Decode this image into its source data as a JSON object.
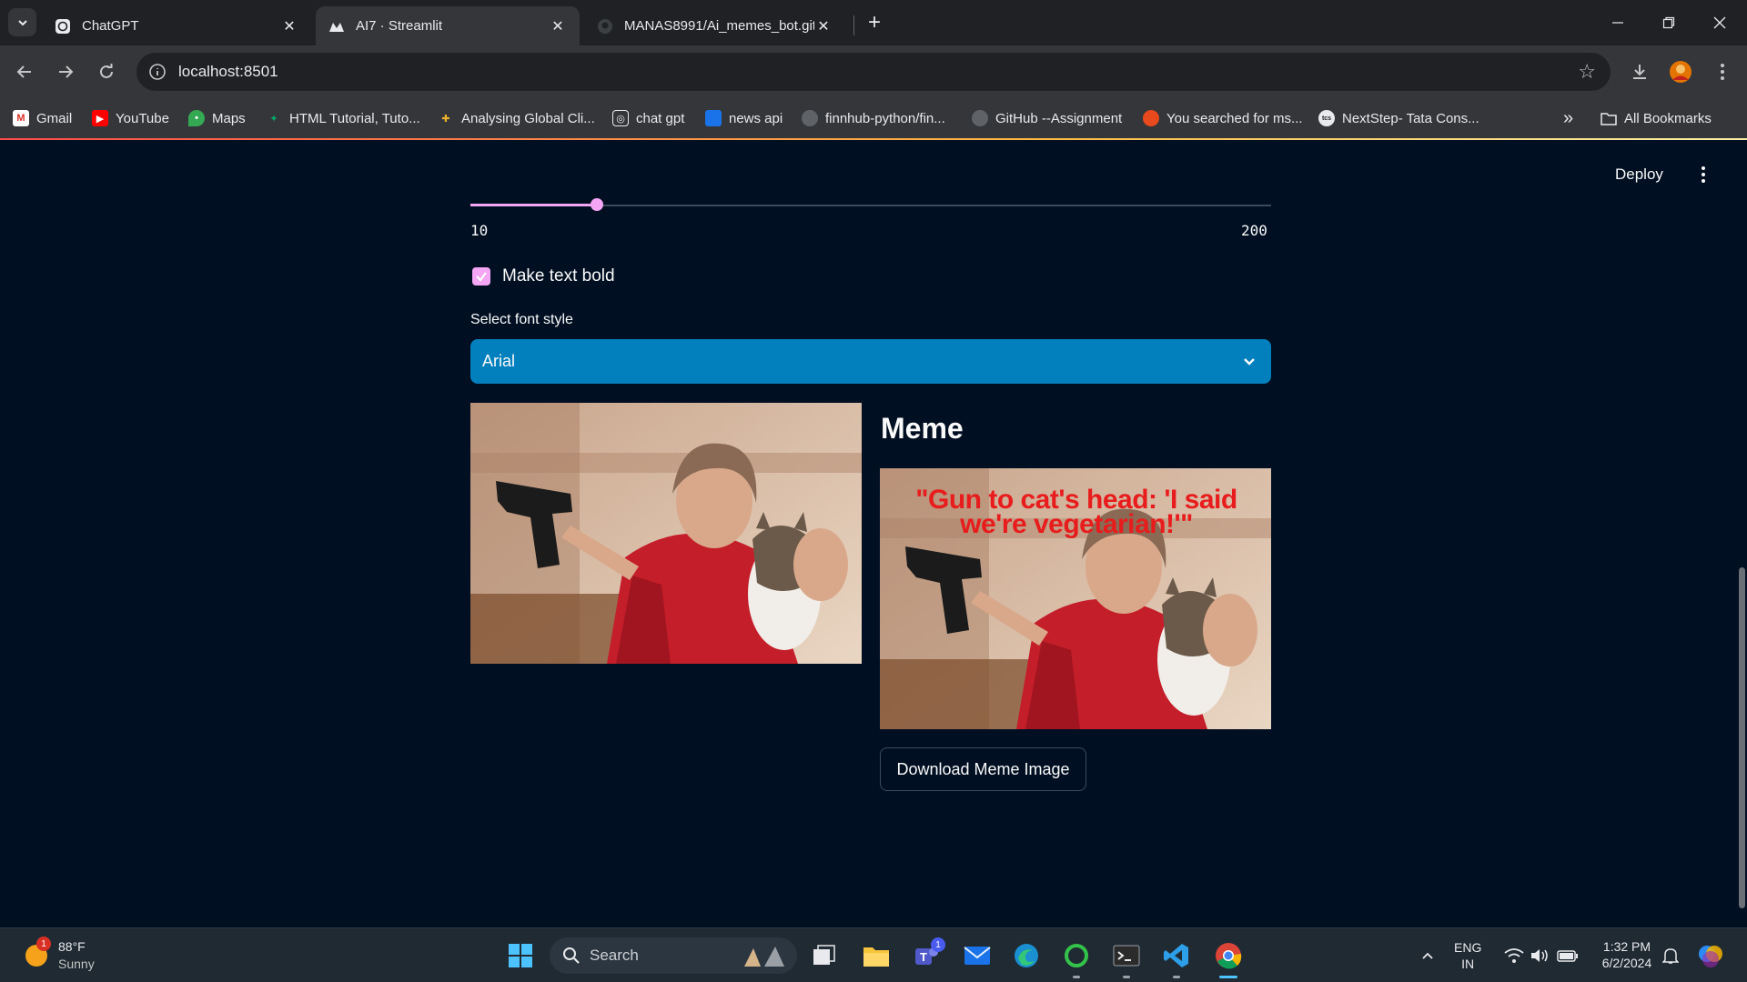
{
  "browser": {
    "tabs": [
      {
        "title": "ChatGPT",
        "icon": "chatgpt-icon"
      },
      {
        "title": "AI7 · Streamlit",
        "icon": "streamlit-icon",
        "active": true
      },
      {
        "title": "MANAS8991/Ai_memes_bot.git",
        "icon": "github-icon"
      }
    ],
    "url": "localhost:8501",
    "bookmarks": [
      {
        "label": "Gmail"
      },
      {
        "label": "YouTube"
      },
      {
        "label": "Maps"
      },
      {
        "label": "HTML Tutorial, Tuto..."
      },
      {
        "label": "Analysing Global Cli..."
      },
      {
        "label": "chat gpt"
      },
      {
        "label": "news api"
      },
      {
        "label": "finnhub-python/fin..."
      },
      {
        "label": "GitHub --Assignment"
      },
      {
        "label": "You searched for ms..."
      },
      {
        "label": "NextStep- Tata Cons..."
      }
    ],
    "all_bookmarks": "All Bookmarks"
  },
  "app": {
    "deploy_label": "Deploy",
    "slider": {
      "min_label": "10",
      "max_label": "200",
      "min": 10,
      "max": 200,
      "value": 40
    },
    "checkbox": {
      "label": "Make text bold",
      "checked": true
    },
    "font_select": {
      "label": "Select font style",
      "value": "Arial"
    },
    "meme_heading": "Meme",
    "meme_caption": "\"Gun to cat's head: 'I said we're vegetarian!'\"",
    "download_label": "Download Meme Image",
    "accent_color": "#f4a6f5",
    "select_color": "#0280be"
  },
  "taskbar": {
    "weather_temp": "88°F",
    "weather_desc": "Sunny",
    "weather_badge": "1",
    "search_placeholder": "Search",
    "teams_badge": "1",
    "lang_line1": "ENG",
    "lang_line2": "IN",
    "time": "1:32 PM",
    "date": "6/2/2024"
  }
}
